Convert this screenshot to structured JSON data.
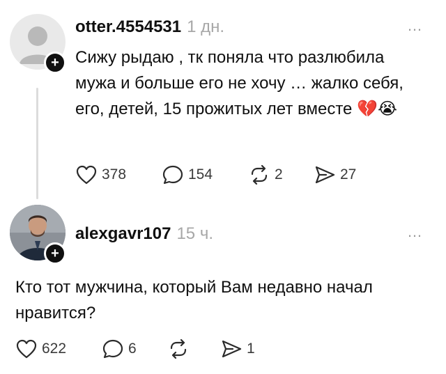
{
  "posts": [
    {
      "username": "otter.4554531",
      "time": "1 дн.",
      "more": "…",
      "text": "Сижу рыдаю , тк поняла что разлюбила мужа и больше его не хочу … жалко себя, его, детей, 15 прожитых лет вместе 💔😭",
      "likes": "378",
      "comments": "154",
      "reposts": "2",
      "shares": "27"
    },
    {
      "username": "alexgavr107",
      "time": "15 ч.",
      "more": "…",
      "text": "Кто тот мужчина, который Вам недавно начал нравится?",
      "likes": "622",
      "comments": "6",
      "reposts": "",
      "shares": "1"
    }
  ],
  "icons": {
    "like": "heart-icon",
    "comment": "comment-icon",
    "repost": "repost-icon",
    "share": "share-icon",
    "follow": "plus-icon"
  }
}
